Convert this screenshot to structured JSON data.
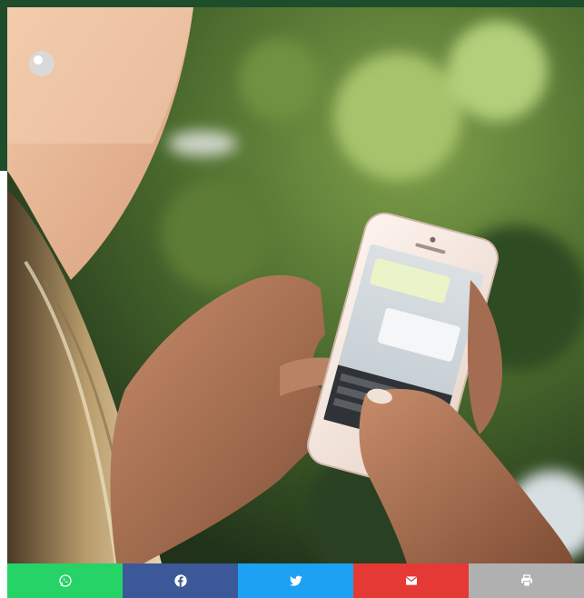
{
  "share_bar": {
    "buttons": [
      {
        "icon": "whatsapp-icon",
        "color": "#25d366"
      },
      {
        "icon": "facebook-icon",
        "color": "#3b5998"
      },
      {
        "icon": "twitter-icon",
        "color": "#1da1f2"
      },
      {
        "icon": "email-icon",
        "color": "#e53935"
      },
      {
        "icon": "print-icon",
        "color": "#b0b0b0"
      }
    ]
  },
  "colors": {
    "header_band": "#1e4d2b"
  }
}
